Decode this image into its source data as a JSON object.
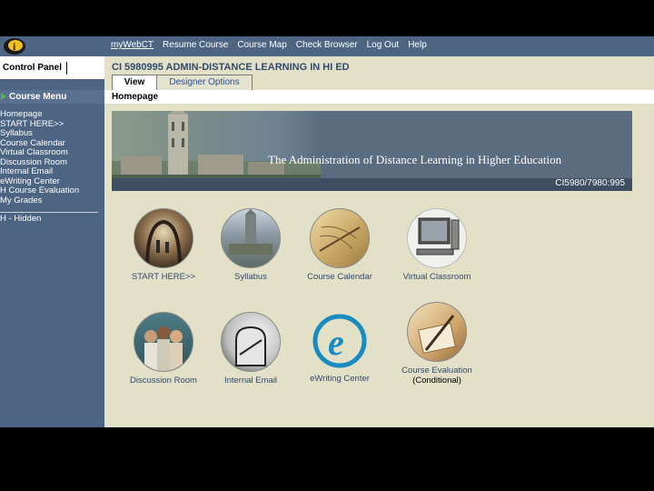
{
  "topnav": {
    "items": [
      "myWebCT",
      "Resume Course",
      "Course Map",
      "Check Browser",
      "Log Out",
      "Help"
    ]
  },
  "control_panel": {
    "label": "Control Panel"
  },
  "course": {
    "title": "CI 5980995 ADMIN-DISTANCE LEARNING IN HI ED"
  },
  "tabs": {
    "view": "View",
    "designer": "Designer Options"
  },
  "sidebar": {
    "menu_title": "Course Menu",
    "items": [
      "Homepage",
      "START HERE>>",
      "Syllabus",
      "Course Calendar",
      "Virtual Classroom",
      "Discussion Room",
      "Internal Email",
      "eWriting Center",
      "H Course Evaluation",
      "My Grades"
    ],
    "legend": "H - Hidden"
  },
  "breadcrumb": "Homepage",
  "banner": {
    "title": "The Administration of Distance Learning in Higher Education",
    "code": "CI5980/7980:995"
  },
  "icons": [
    {
      "label": "START HERE>>"
    },
    {
      "label": "Syllabus"
    },
    {
      "label": "Course Calendar"
    },
    {
      "label": "Virtual Classroom"
    },
    {
      "label": "Discussion Room"
    },
    {
      "label": "Internal Email"
    },
    {
      "label": "eWriting Center"
    },
    {
      "label": "Course Evaluation",
      "sub": "(Conditional)"
    }
  ],
  "colors": {
    "nav": "#4d6582",
    "page": "#e2e0c7",
    "title": "#34496c"
  }
}
